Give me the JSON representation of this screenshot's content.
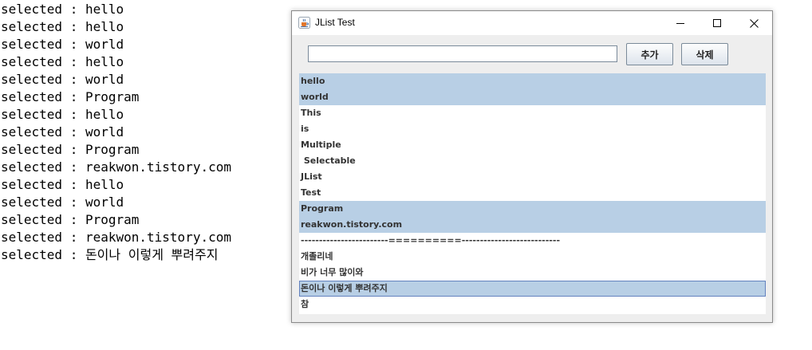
{
  "console": {
    "lines": [
      "selected : hello",
      "selected : hello",
      "selected : world",
      "selected : hello",
      "selected : world",
      "selected : Program",
      "selected : hello",
      "selected : world",
      "selected : Program",
      "selected : reakwon.tistory.com",
      "selected : hello",
      "selected : world",
      "selected : Program",
      "selected : reakwon.tistory.com",
      "selected : 돈이나 이렇게 뿌려주지"
    ]
  },
  "window": {
    "title": "JList Test",
    "icon": "java-cup-icon",
    "controls": [
      "minimize-icon",
      "maximize-icon",
      "close-icon"
    ]
  },
  "form": {
    "input_value": "",
    "add_label": "추가",
    "delete_label": "삭제"
  },
  "list": {
    "items": [
      {
        "label": "hello",
        "selected": true
      },
      {
        "label": "world",
        "selected": true
      },
      {
        "label": "This",
        "selected": false
      },
      {
        "label": "is",
        "selected": false
      },
      {
        "label": "Multiple",
        "selected": false
      },
      {
        "label": " Selectable",
        "selected": false
      },
      {
        "label": "JList",
        "selected": false
      },
      {
        "label": "Test",
        "selected": false
      },
      {
        "label": "Program",
        "selected": true
      },
      {
        "label": "reakwon.tistory.com",
        "selected": true
      },
      {
        "label": "------------------------==========---------------------------",
        "selected": false
      },
      {
        "label": "개졸리네",
        "selected": false
      },
      {
        "label": "비가 너무 많이와",
        "selected": false
      },
      {
        "label": "돈이나 이렇게 뿌려주지",
        "selected": true,
        "focused": true
      },
      {
        "label": "참",
        "selected": false
      }
    ]
  },
  "colors": {
    "selection": "#b8cfe5",
    "focus_border": "#6382bf",
    "window_bg": "#eeeeee"
  }
}
